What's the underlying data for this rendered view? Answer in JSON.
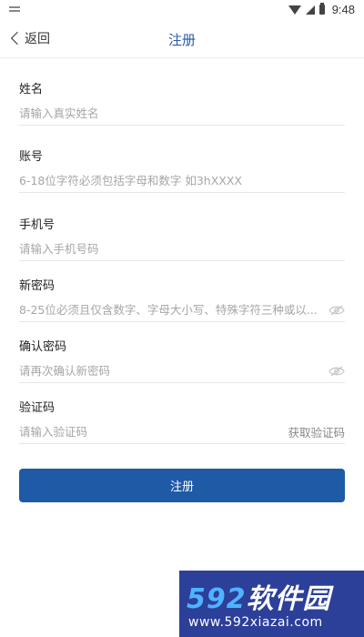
{
  "status_bar": {
    "time": "9:48"
  },
  "header": {
    "back_label": "返回",
    "title": "注册"
  },
  "form": {
    "name": {
      "label": "姓名",
      "placeholder": "请输入真实姓名"
    },
    "account": {
      "label": "账号",
      "placeholder": "6-18位字符必须包括字母和数字 如3hXXXX"
    },
    "phone": {
      "label": "手机号",
      "placeholder": "请输入手机号码"
    },
    "new_password": {
      "label": "新密码",
      "placeholder": "8-25位必须且仅含数字、字母大小写、特殊字符三种或以..."
    },
    "confirm_password": {
      "label": "确认密码",
      "placeholder": "请再次确认新密码"
    },
    "code": {
      "label": "验证码",
      "placeholder": "请输入验证码",
      "get_code_label": "获取验证码"
    },
    "submit_label": "注册"
  },
  "watermark": {
    "brand_num": "592",
    "brand_text": "软件园",
    "url": "www.592xiazai.com"
  },
  "colors": {
    "accent": "#1f5aa6",
    "title": "#2a5aa8",
    "watermark_bg": "#2c3f99"
  },
  "icons": [
    "notification-icon",
    "wifi-icon",
    "signal-icon",
    "battery-icon",
    "back-chevron-icon",
    "eye-hidden-icon"
  ]
}
